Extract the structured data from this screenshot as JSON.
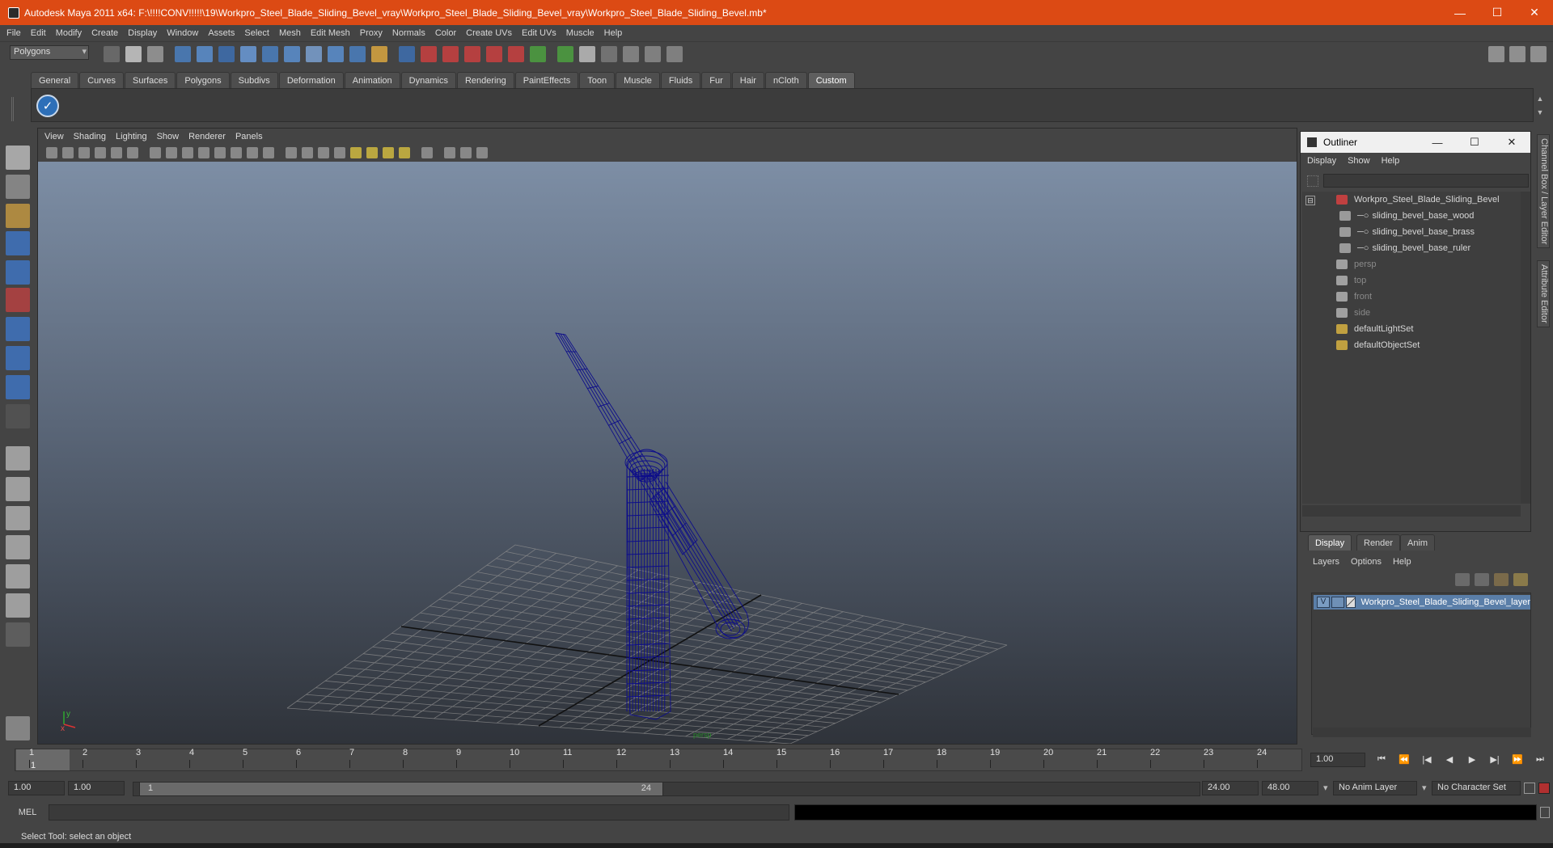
{
  "window": {
    "title": "Autodesk Maya 2011 x64: F:\\!!!!CONV!!!!!\\19\\Workpro_Steel_Blade_Sliding_Bevel_vray\\Workpro_Steel_Blade_Sliding_Bevel_vray\\Workpro_Steel_Blade_Sliding_Bevel.mb*",
    "minimize": "—",
    "maximize": "☐",
    "close": "✕"
  },
  "menubar": [
    "File",
    "Edit",
    "Modify",
    "Create",
    "Display",
    "Window",
    "Assets",
    "Select",
    "Mesh",
    "Edit Mesh",
    "Proxy",
    "Normals",
    "Color",
    "Create UVs",
    "Edit UVs",
    "Muscle",
    "Help"
  ],
  "statusline": {
    "mode": "Polygons"
  },
  "shelf": {
    "tabs": [
      "General",
      "Curves",
      "Surfaces",
      "Polygons",
      "Subdivs",
      "Deformation",
      "Animation",
      "Dynamics",
      "Rendering",
      "PaintEffects",
      "Toon",
      "Muscle",
      "Fluids",
      "Fur",
      "Hair",
      "nCloth",
      "Custom"
    ],
    "active_tab": "Custom"
  },
  "viewport": {
    "menu": [
      "View",
      "Shading",
      "Lighting",
      "Show",
      "Renderer",
      "Panels"
    ],
    "camera_label": "persp",
    "axis_x": "x",
    "axis_y": "y",
    "wire_color": "#0d0d8a"
  },
  "outliner": {
    "title": "Outliner",
    "menu": [
      "Display",
      "Show",
      "Help"
    ],
    "collapse_symbol": "⊟",
    "items": [
      {
        "label": "Workpro_Steel_Blade_Sliding_Bevel",
        "dim": false,
        "depth": 0,
        "icon": "group-icon"
      },
      {
        "label": "sliding_bevel_base_wood",
        "dim": false,
        "depth": 1,
        "icon": "mesh-icon"
      },
      {
        "label": "sliding_bevel_base_brass",
        "dim": false,
        "depth": 1,
        "icon": "mesh-icon"
      },
      {
        "label": "sliding_bevel_base_ruler",
        "dim": false,
        "depth": 1,
        "icon": "mesh-icon"
      },
      {
        "label": "persp",
        "dim": true,
        "depth": 0,
        "icon": "camera-icon"
      },
      {
        "label": "top",
        "dim": true,
        "depth": 0,
        "icon": "camera-icon"
      },
      {
        "label": "front",
        "dim": true,
        "depth": 0,
        "icon": "camera-icon"
      },
      {
        "label": "side",
        "dim": true,
        "depth": 0,
        "icon": "camera-icon"
      },
      {
        "label": "defaultLightSet",
        "dim": false,
        "depth": 0,
        "icon": "set-icon"
      },
      {
        "label": "defaultObjectSet",
        "dim": false,
        "depth": 0,
        "icon": "set-icon"
      }
    ]
  },
  "layer_editor": {
    "tabs": [
      "Display",
      "Render",
      "Anim"
    ],
    "active_tab": "Display",
    "menu": [
      "Layers",
      "Options",
      "Help"
    ],
    "layer": {
      "visible": "V",
      "name": "Workpro_Steel_Blade_Sliding_Bevel_layer"
    }
  },
  "side_tabs": [
    "Channel Box / Layer Editor",
    "Attribute Editor"
  ],
  "timeline": {
    "ticks": [
      "1",
      "2",
      "3",
      "4",
      "5",
      "6",
      "7",
      "8",
      "9",
      "10",
      "11",
      "12",
      "13",
      "14",
      "15",
      "16",
      "17",
      "18",
      "19",
      "20",
      "21",
      "22",
      "23",
      "24"
    ],
    "current_frame": "1",
    "current_field": "1.00"
  },
  "playback_buttons": [
    "⏮",
    "⏪",
    "|◀",
    "◀",
    "▶",
    "▶|",
    "⏩",
    "⏭"
  ],
  "range": {
    "start": "1.00",
    "anim_start": "1.00",
    "handle_start": "1",
    "handle_end": "24",
    "end": "24.00",
    "anim_end": "48.00",
    "anim_layer": "No Anim Layer",
    "char_set": "No Character Set"
  },
  "command": {
    "label": "MEL"
  },
  "help_line": "Select Tool: select an object"
}
